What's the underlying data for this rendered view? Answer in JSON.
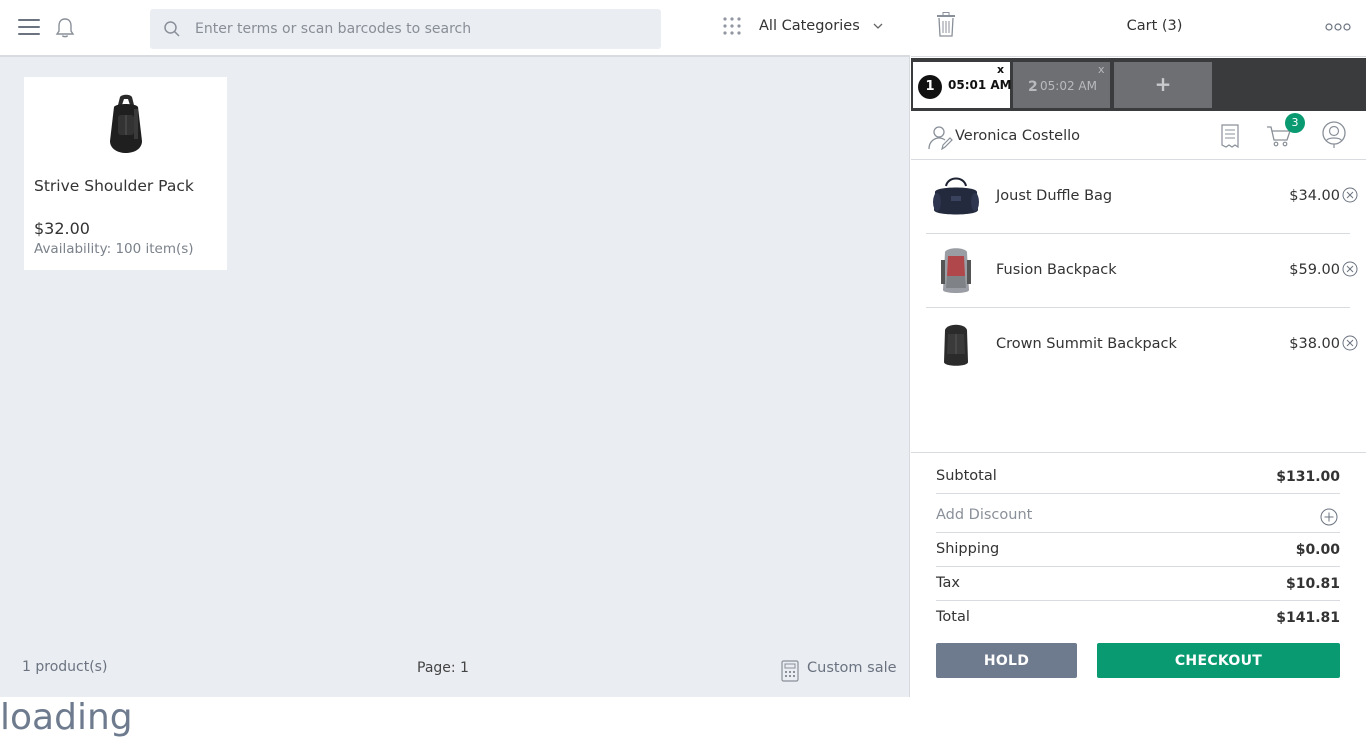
{
  "search": {
    "placeholder": "Enter terms or scan barcodes to search"
  },
  "categories": {
    "selected": "All Categories"
  },
  "products": [
    {
      "name": "Strive Shoulder Pack",
      "price": "$32.00",
      "availability": "Availability: 100 item(s)"
    }
  ],
  "footer": {
    "count": "1 product(s)",
    "page": "Page: 1",
    "custom_sale": "Custom sale"
  },
  "cart": {
    "title": "Cart (3)",
    "tabs": [
      {
        "num": "1",
        "time": "05:01 AM",
        "close": "x"
      },
      {
        "num": "2",
        "time": "05:02 AM",
        "close": "x"
      }
    ],
    "add_tab": "+",
    "customer": "Veronica Costello",
    "badge": "3",
    "items": [
      {
        "name": "Joust Duffle Bag",
        "price": "$34.00"
      },
      {
        "name": "Fusion Backpack",
        "price": "$59.00"
      },
      {
        "name": "Crown Summit Backpack",
        "price": "$38.00"
      }
    ],
    "totals": {
      "subtotal_label": "Subtotal",
      "subtotal": "$131.00",
      "discount_label": "Add Discount",
      "shipping_label": "Shipping",
      "shipping": "$0.00",
      "tax_label": "Tax",
      "tax": "$10.81",
      "total_label": "Total",
      "total": "$141.81"
    },
    "hold_label": "HOLD",
    "checkout_label": "CHECKOUT"
  },
  "status": {
    "loading": "loading"
  },
  "colors": {
    "accent": "#0a9a72",
    "hold": "#6e7b8f",
    "panel_bg": "#eaedf2",
    "tab_bar": "#3a3b3d"
  }
}
